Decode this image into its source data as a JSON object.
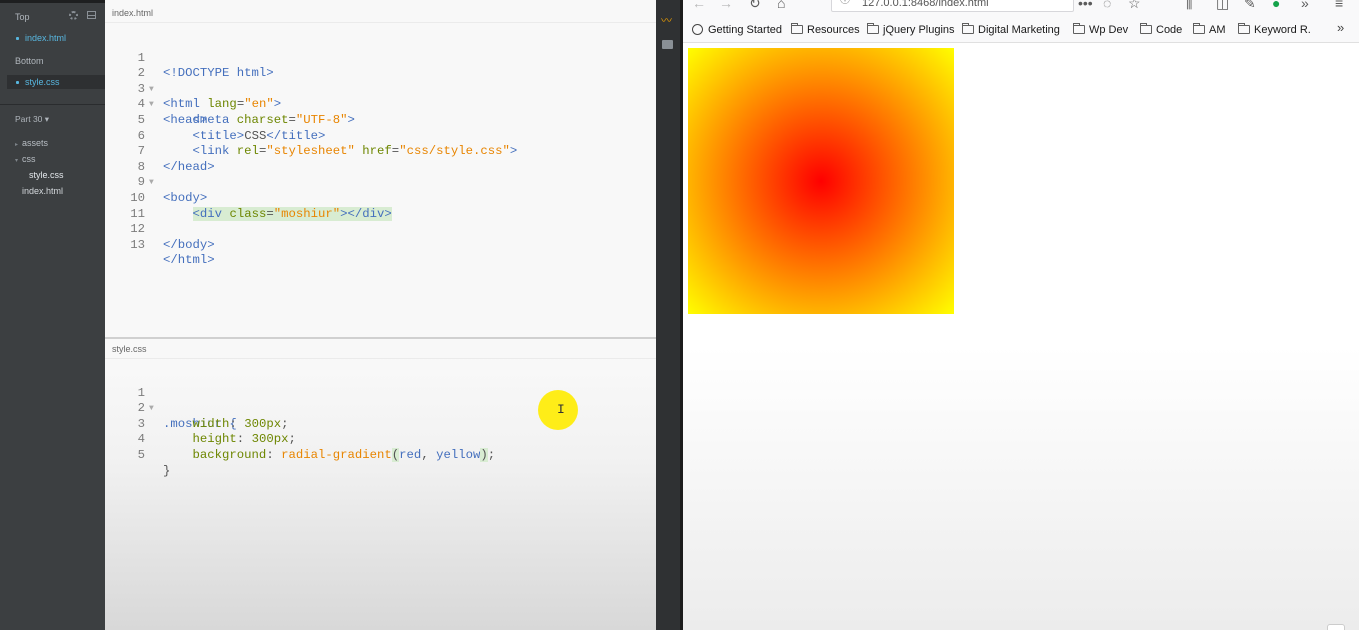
{
  "sidebar": {
    "working_files_label": "Top",
    "top_file": "index.html",
    "bottom_label": "Bottom",
    "bottom_file": "style.css",
    "project_label": "Part 30 ▾",
    "tree": [
      {
        "name": "assets",
        "type": "folder",
        "state": "collapsed"
      },
      {
        "name": "css",
        "type": "folder",
        "state": "expanded"
      },
      {
        "name": "style.css",
        "type": "file",
        "indent": 1
      },
      {
        "name": "index.html",
        "type": "file",
        "indent": 0
      }
    ]
  },
  "editor": {
    "top_title": "index.html",
    "bottom_title": "style.css",
    "html_lines": [
      {
        "n": "1",
        "fold": ""
      },
      {
        "n": "2",
        "fold": "▼"
      },
      {
        "n": "3",
        "fold": "▼"
      },
      {
        "n": "4",
        "fold": ""
      },
      {
        "n": "5",
        "fold": ""
      },
      {
        "n": "6",
        "fold": ""
      },
      {
        "n": "7",
        "fold": ""
      },
      {
        "n": "8",
        "fold": "▼"
      },
      {
        "n": "9",
        "fold": ""
      },
      {
        "n": "10",
        "fold": ""
      },
      {
        "n": "11",
        "fold": ""
      },
      {
        "n": "12",
        "fold": ""
      },
      {
        "n": "13",
        "fold": ""
      }
    ],
    "html_code": {
      "l1": "<!DOCTYPE html>",
      "l2a": "<html ",
      "l2b": "lang",
      "l2c": "=",
      "l2d": "\"en\"",
      "l2e": ">",
      "l3": "<head>",
      "l4a": "    <meta ",
      "l4b": "charset",
      "l4c": "=",
      "l4d": "\"UTF-8\"",
      "l4e": ">",
      "l5a": "    <title>",
      "l5b": "CSS",
      "l5c": "</title>",
      "l6a": "    <link ",
      "l6b": "rel",
      "l6c": "=",
      "l6d": "\"stylesheet\"",
      "l6e": " href",
      "l6f": "=",
      "l6g": "\"css/style.css\"",
      "l6h": ">",
      "l7": "</head>",
      "l8": "<body>",
      "l10a": "    ",
      "l10b": "<div ",
      "l10c": "class",
      "l10d": "=",
      "l10e": "\"moshiur\"",
      "l10f": "></div>",
      "l12": "</body>",
      "l13": "</html>"
    },
    "css_lines": [
      {
        "n": "1",
        "fold": "▼"
      },
      {
        "n": "2",
        "fold": ""
      },
      {
        "n": "3",
        "fold": ""
      },
      {
        "n": "4",
        "fold": ""
      },
      {
        "n": "5",
        "fold": ""
      }
    ],
    "css_code": {
      "l1": ".moshiur {",
      "l2a": "    width",
      "l2b": ": ",
      "l2c": "300px",
      "l2d": ";",
      "l3a": "    height",
      "l3b": ": ",
      "l3c": "300px",
      "l3d": ";",
      "l4a": "    background",
      "l4b": ": ",
      "l4c": "radial-gradient",
      "l4d": "(",
      "l4e": "red",
      "l4f": ", ",
      "l4g": "yellow",
      "l4h": ")",
      "l4i": ";",
      "l5": "}"
    },
    "text_cursor_glyph": "I"
  },
  "toolbar": {
    "live_preview_icon": "live-preview-icon",
    "extensions_icon": "extension-manager-icon"
  },
  "browser": {
    "url": "127.0.0.1:8468/index.html",
    "bookmarks": [
      {
        "label": "Getting Started",
        "icon": "globe-icon"
      },
      {
        "label": "Resources",
        "icon": "folder-icon"
      },
      {
        "label": "jQuery Plugins",
        "icon": "folder-icon"
      },
      {
        "label": "Digital Marketing",
        "icon": "folder-icon"
      },
      {
        "label": "Wp Dev",
        "icon": "folder-icon"
      },
      {
        "label": "Code",
        "icon": "folder-icon"
      },
      {
        "label": "AM",
        "icon": "folder-icon"
      },
      {
        "label": "Keyword R.",
        "icon": "folder-icon"
      }
    ],
    "overflow": "»",
    "gradient": {
      "center": "#ff0000",
      "edge": "#ffff00"
    }
  }
}
